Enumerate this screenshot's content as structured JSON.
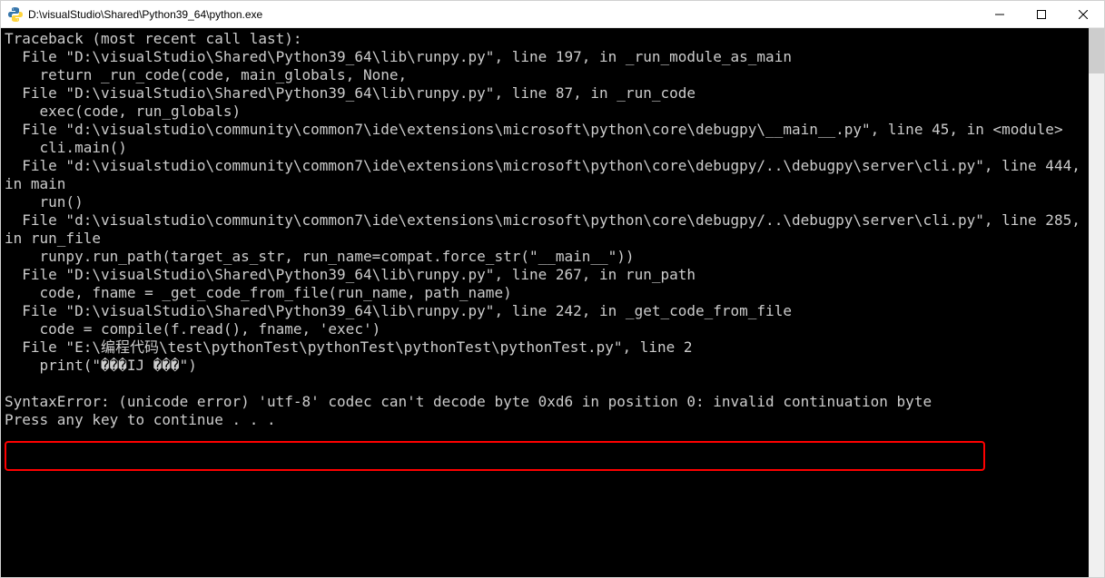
{
  "window": {
    "title": "D:\\visualStudio\\Shared\\Python39_64\\python.exe"
  },
  "console": {
    "lines": [
      "Traceback (most recent call last):",
      "  File \"D:\\visualStudio\\Shared\\Python39_64\\lib\\runpy.py\", line 197, in _run_module_as_main",
      "    return _run_code(code, main_globals, None,",
      "  File \"D:\\visualStudio\\Shared\\Python39_64\\lib\\runpy.py\", line 87, in _run_code",
      "    exec(code, run_globals)",
      "  File \"d:\\visualstudio\\community\\common7\\ide\\extensions\\microsoft\\python\\core\\debugpy\\__main__.py\", line 45, in <module>",
      "    cli.main()",
      "  File \"d:\\visualstudio\\community\\common7\\ide\\extensions\\microsoft\\python\\core\\debugpy/..\\debugpy\\server\\cli.py\", line 444, in main",
      "    run()",
      "  File \"d:\\visualstudio\\community\\common7\\ide\\extensions\\microsoft\\python\\core\\debugpy/..\\debugpy\\server\\cli.py\", line 285, in run_file",
      "    runpy.run_path(target_as_str, run_name=compat.force_str(\"__main__\"))",
      "  File \"D:\\visualStudio\\Shared\\Python39_64\\lib\\runpy.py\", line 267, in run_path",
      "    code, fname = _get_code_from_file(run_name, path_name)",
      "  File \"D:\\visualStudio\\Shared\\Python39_64\\lib\\runpy.py\", line 242, in _get_code_from_file",
      "    code = compile(f.read(), fname, 'exec')",
      "  File \"E:\\编程代码\\test\\pythonTest\\pythonTest\\pythonTest\\pythonTest.py\", line 2",
      "    print(\"���IJ ���\")",
      "",
      "SyntaxError: (unicode error) 'utf-8' codec can't decode byte 0xd6 in position 0: invalid continuation byte",
      "Press any key to continue . . ."
    ],
    "error_line": "SyntaxError: (unicode error) 'utf-8' codec can't decode byte 0xd6 in position 0: invalid continuation byte"
  }
}
